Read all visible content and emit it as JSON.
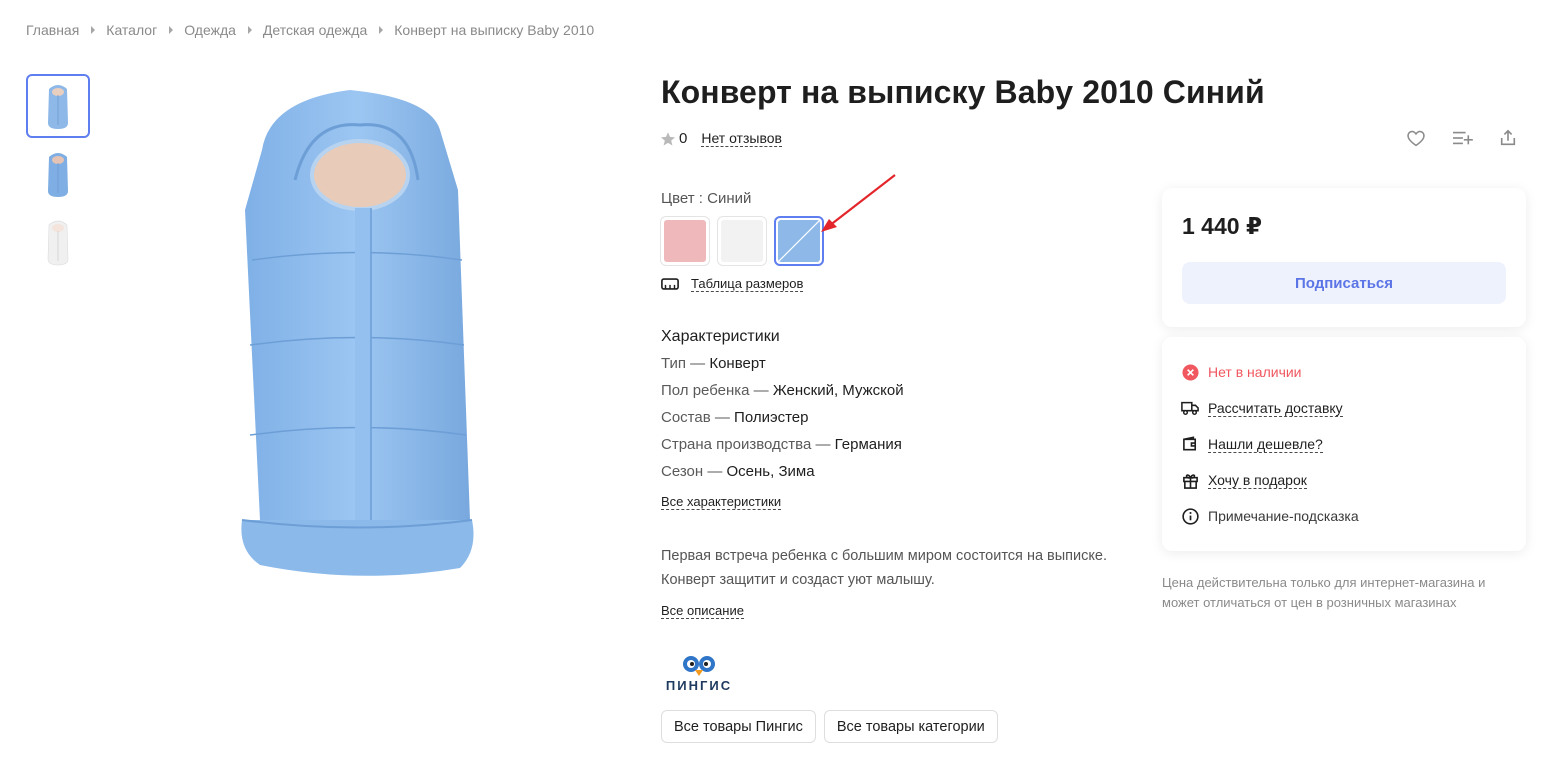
{
  "breadcrumb": [
    "Главная",
    "Каталог",
    "Одежда",
    "Детская одежда",
    "Конверт на выписку Baby 2010"
  ],
  "product": {
    "title": "Конверт на выписку Baby 2010 Синий",
    "rating_count": "0",
    "reviews_link": "Нет отзывов",
    "color_label": "Цвет : Синий",
    "swatches": [
      {
        "name": "pink",
        "color": "#efb9bb",
        "selected": false
      },
      {
        "name": "white",
        "color": "#f2f2f2",
        "selected": false
      },
      {
        "name": "blue",
        "color": "#8db8e8",
        "selected": true
      }
    ],
    "size_table_link": "Таблица размеров"
  },
  "specs": {
    "heading": "Характеристики",
    "rows": [
      {
        "label": "Тип — ",
        "value": "Конверт"
      },
      {
        "label": "Пол ребенка — ",
        "value": "Женский, Мужской"
      },
      {
        "label": "Состав — ",
        "value": "Полиэстер"
      },
      {
        "label": "Страна производства — ",
        "value": "Германия"
      },
      {
        "label": "Сезон — ",
        "value": "Осень, Зима"
      }
    ],
    "all_link": "Все характеристики"
  },
  "description": {
    "line1": "Первая встреча ребенка с большим миром состоится на выписке.",
    "line2": "Конверт защитит и создаст уют малышу.",
    "all_link": "Все описание"
  },
  "brand": {
    "name": "ПИНГИС",
    "btn_brand": "Все товары Пингис",
    "btn_category": "Все товары категории"
  },
  "price_card": {
    "price": "1 440 ₽",
    "subscribe": "Подписаться"
  },
  "info_card": {
    "stock": "Нет в наличии",
    "delivery": "Рассчитать доставку",
    "cheaper": "Нашли дешевле?",
    "gift": "Хочу в подарок",
    "note": "Примечание-подсказка"
  },
  "disclaimer": "Цена действительна только для интернет-магазина и может отличаться от цен в розничных магазинах",
  "colors": {
    "accent": "#5f7ef0",
    "error": "#f0575f",
    "annotation_arrow": "#e3262b",
    "product_blue": "#8db8e8"
  }
}
